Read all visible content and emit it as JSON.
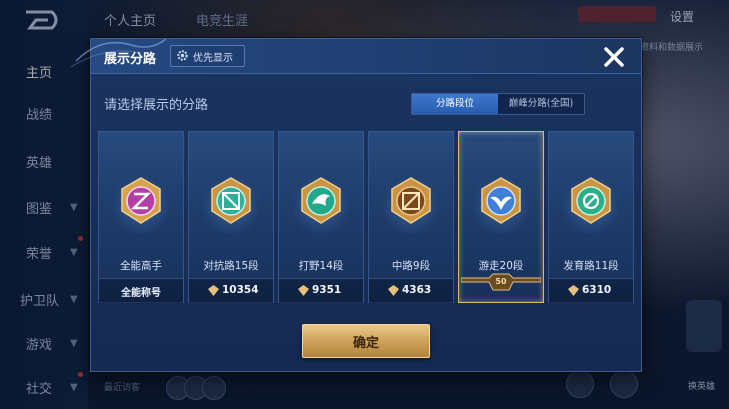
{
  "background": {
    "sidebar": {
      "items": [
        {
          "label": "主页",
          "active": true
        },
        {
          "label": "战绩",
          "active": false
        },
        {
          "label": "英雄",
          "active": false
        },
        {
          "label": "图鉴",
          "active": false
        },
        {
          "label": "荣誉",
          "active": false
        },
        {
          "label": "护卫队",
          "active": false
        },
        {
          "label": "游戏",
          "active": false
        },
        {
          "label": "社交",
          "active": false
        }
      ]
    },
    "top_tabs": [
      "个人主页",
      "电竞生涯"
    ],
    "settings_label": "设置",
    "right_hint": "资料和数据展示",
    "visitors_label": "最近访客",
    "right_hero_label": "换英雄"
  },
  "modal": {
    "title": "展示分路",
    "priority_button": "优先显示",
    "subtitle": "请选择展示的分路",
    "segments": {
      "active": "分路段位",
      "inactive": "巅峰分路(全国)"
    },
    "cards": [
      {
        "name": "全能高手",
        "footer_text": "全能称号",
        "points": null,
        "selected": false,
        "color": "#b23ea8"
      },
      {
        "name": "对抗路15段",
        "footer_text": null,
        "points": "10354",
        "selected": false,
        "color": "#2fae9c"
      },
      {
        "name": "打野14段",
        "footer_text": null,
        "points": "9351",
        "selected": false,
        "color": "#23a98a"
      },
      {
        "name": "中路9段",
        "footer_text": null,
        "points": "4363",
        "selected": false,
        "color": "#c7772c"
      },
      {
        "name": "游走20段",
        "footer_text": null,
        "points": null,
        "rank_badge": "50",
        "selected": true,
        "color": "#3f7fd8"
      },
      {
        "name": "发育路11段",
        "footer_text": null,
        "points": "6310",
        "selected": false,
        "color": "#29b088"
      }
    ],
    "confirm_label": "确定"
  },
  "colors": {
    "accent_gold": "#d7a95f",
    "panel_blue": "#1c3561",
    "active_tab": "#3e78d0"
  }
}
